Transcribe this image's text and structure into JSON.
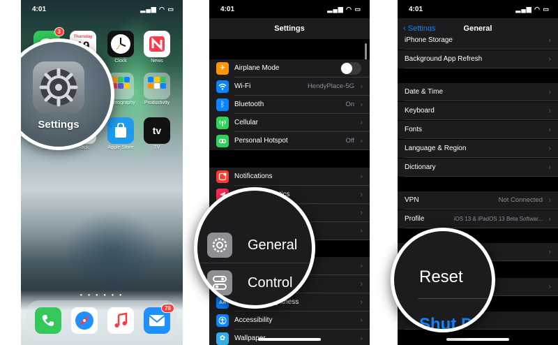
{
  "home": {
    "time": "4:01",
    "calendar_day": "Thursday",
    "calendar_date": "19",
    "apps": [
      {
        "label": "Clock"
      },
      {
        "label": "News"
      },
      {
        "label": "Photography"
      },
      {
        "label": "Productivity"
      },
      {
        "label": "Store"
      },
      {
        "label": "Slack"
      },
      {
        "label": "Apple Store"
      },
      {
        "label": "TV"
      }
    ],
    "tv_glyph": "tv",
    "messages_badge": "3",
    "mail_badge": "78",
    "zoom_label": "Settings"
  },
  "settings": {
    "time": "4:01",
    "title": "Settings",
    "rows": [
      {
        "label": "Airplane Mode",
        "value": "",
        "color": "#ff9500",
        "icon": "airplane-icon"
      },
      {
        "label": "Wi-Fi",
        "value": "HendyPlace-5G",
        "color": "#0a84ff",
        "icon": "wifi-icon"
      },
      {
        "label": "Bluetooth",
        "value": "On",
        "color": "#0a84ff",
        "icon": "bluetooth-icon"
      },
      {
        "label": "Cellular",
        "value": "",
        "color": "#30d158",
        "icon": "cellular-icon"
      },
      {
        "label": "Personal Hotspot",
        "value": "Off",
        "color": "#30d158",
        "icon": "hotspot-icon"
      },
      {
        "label": "Notifications",
        "value": "",
        "color": "#ff3b30",
        "icon": "notifications-icon"
      },
      {
        "label": "Sounds & Haptics",
        "value": "",
        "color": "#ff2d55",
        "icon": "sounds-icon"
      },
      {
        "label": "Display & Brightness",
        "value": "",
        "color": "#0a84ff",
        "icon": "display-icon"
      },
      {
        "label": "Accessibility",
        "value": "",
        "color": "#0a84ff",
        "icon": "accessibility-icon"
      },
      {
        "label": "Wallpaper",
        "value": "",
        "color": "#32ade6",
        "icon": "wallpaper-icon"
      }
    ],
    "zoom": {
      "general": "General",
      "control": "Control"
    }
  },
  "general": {
    "time": "4:01",
    "back_label": "Settings",
    "title": "General",
    "rows": [
      {
        "label": "iPhone Storage",
        "value": ""
      },
      {
        "label": "Background App Refresh",
        "value": ""
      },
      {
        "label": "Date & Time",
        "value": ""
      },
      {
        "label": "Keyboard",
        "value": ""
      },
      {
        "label": "Fonts",
        "value": ""
      },
      {
        "label": "Language & Region",
        "value": ""
      },
      {
        "label": "Dictionary",
        "value": ""
      },
      {
        "label": "VPN",
        "value": "Not Connected"
      },
      {
        "label": "Profile",
        "value": "iOS 13 & iPadOS 13 Beta Softwar..."
      }
    ],
    "zoom": {
      "reset": "Reset",
      "shut_down": "Shut D"
    }
  },
  "colors": {
    "accent": "#0a84ff",
    "cell_background": "#1c1c1e",
    "screen_background": "#000000"
  }
}
